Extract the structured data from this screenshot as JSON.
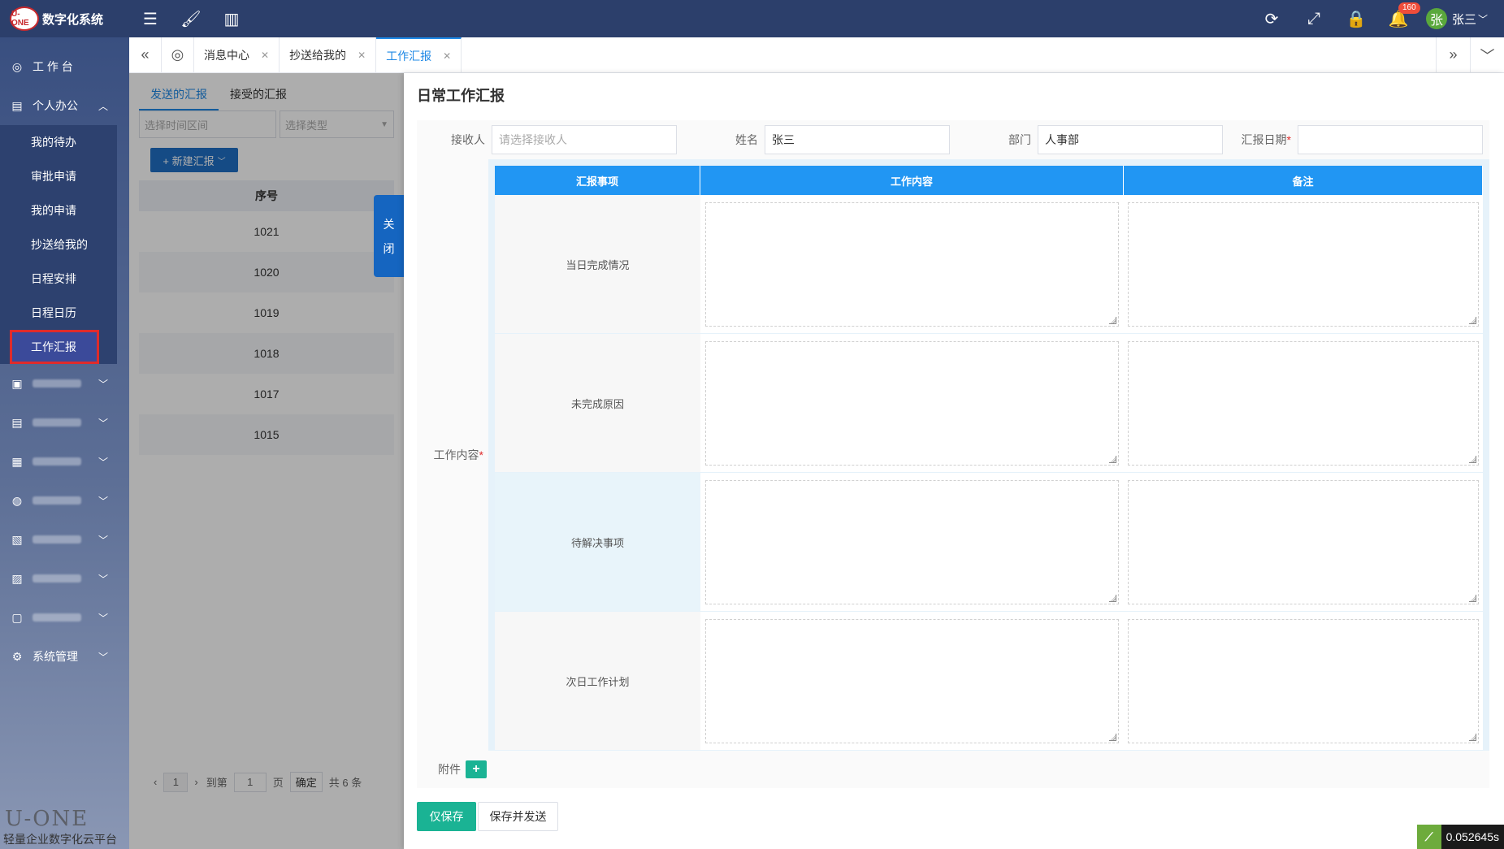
{
  "brand": {
    "logo": "U-ONE",
    "title": "数字化系统"
  },
  "topbar": {
    "notification_count": "160",
    "user_avatar": "张",
    "user_name": "张三"
  },
  "sidebar": {
    "workbench": "工 作 台",
    "personal_office": "个人办公",
    "sub_items": [
      "我的待办",
      "审批申请",
      "我的申请",
      "抄送给我的",
      "日程安排",
      "日程日历",
      "工作汇报"
    ],
    "system_manage": "系统管理",
    "footer_logo": "U-ONE",
    "footer_slogan": "轻量企业数字化云平台"
  },
  "tabs": {
    "items": [
      "消息中心",
      "抄送给我的",
      "工作汇报"
    ]
  },
  "list": {
    "tab_sent": "发送的汇报",
    "tab_received": "接受的汇报",
    "filter_time_placeholder": "选择时间区间",
    "filter_type_placeholder": "选择类型",
    "new_button": "+ 新建汇报",
    "col_no": "序号",
    "rows": [
      "1021",
      "1020",
      "1019",
      "1018",
      "1017",
      "1015"
    ],
    "pager": {
      "page": "1",
      "goto_label": "到第",
      "goto_value": "1",
      "page_unit": "页",
      "confirm": "确定",
      "total": "共 6 条"
    }
  },
  "close_tab": {
    "char1": "关",
    "char2": "闭"
  },
  "drawer": {
    "title": "日常工作汇报",
    "receiver_label": "接收人",
    "receiver_placeholder": "请选择接收人",
    "name_label": "姓名",
    "name_value": "张三",
    "dept_label": "部门",
    "dept_value": "人事部",
    "date_label": "汇报日期",
    "content_label": "工作内容",
    "grid_headers": [
      "汇报事项",
      "工作内容",
      "备注"
    ],
    "grid_rows": [
      "当日完成情况",
      "未完成原因",
      "待解决事项",
      "次日工作计划"
    ],
    "attach_label": "附件",
    "save_only": "仅保存",
    "save_send": "保存并发送"
  },
  "timer": "0.052645s"
}
